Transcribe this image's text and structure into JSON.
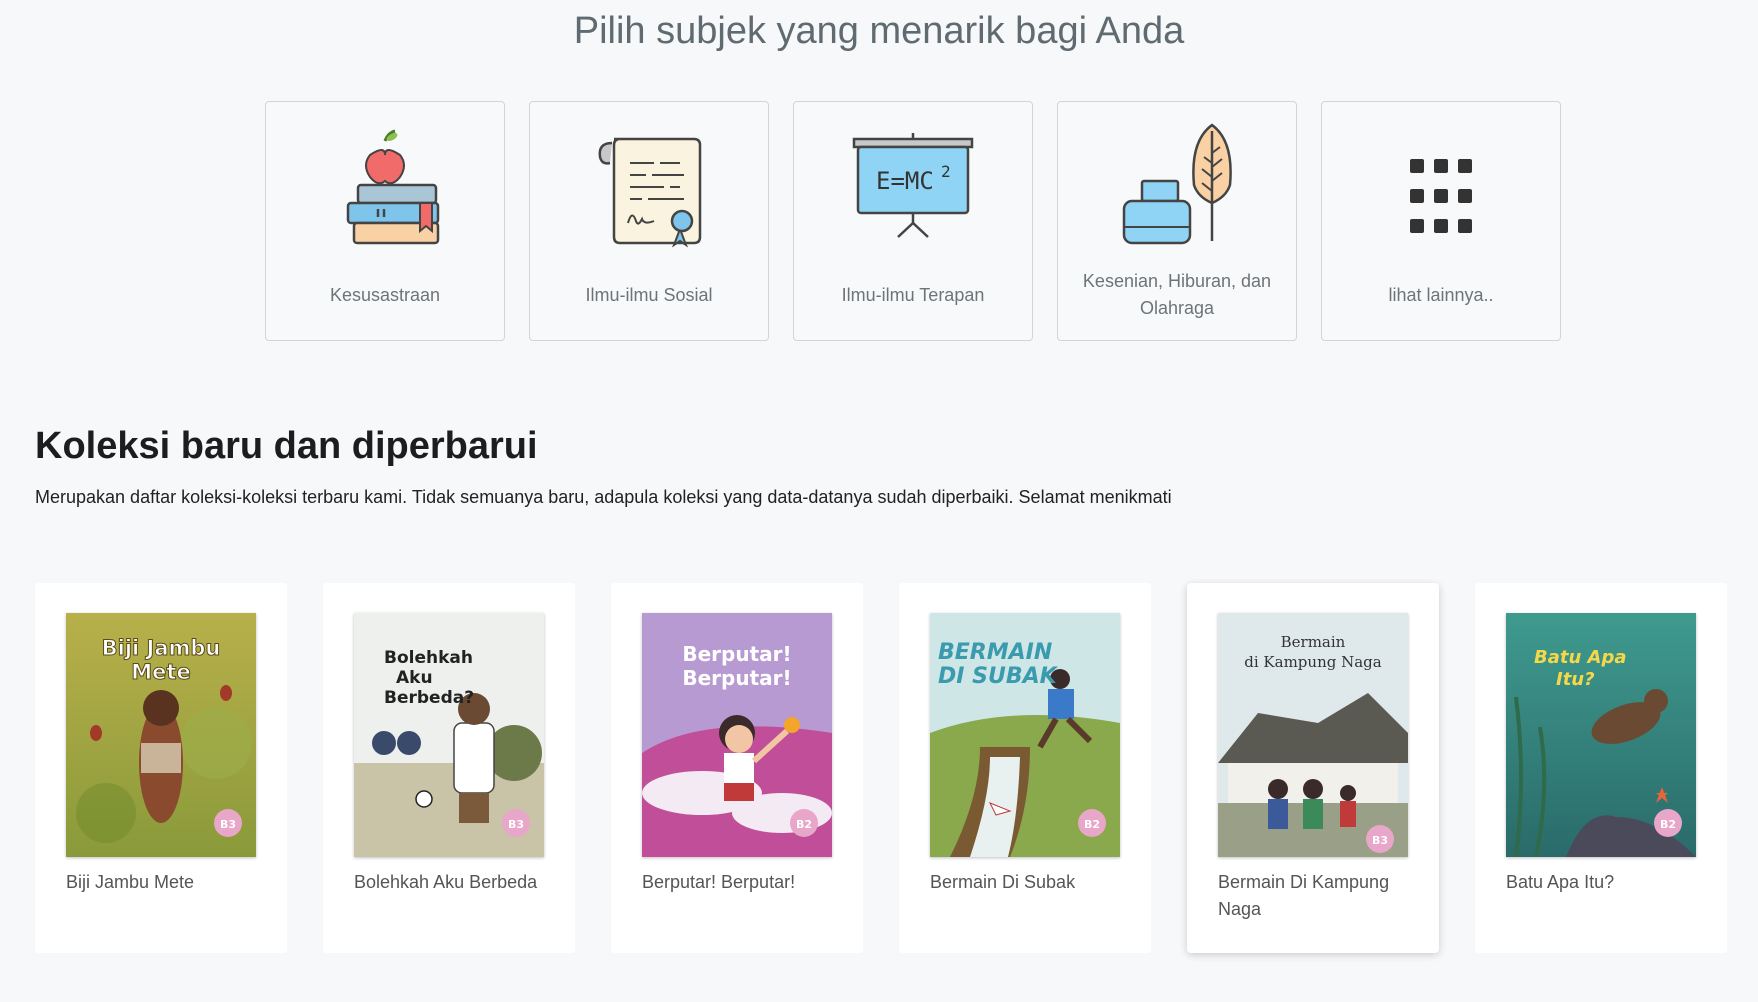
{
  "subjects_heading": "Pilih subjek yang menarik bagi Anda",
  "subjects": [
    {
      "label": "Kesusastraan",
      "icon": "books-apple-icon"
    },
    {
      "label": "Ilmu-ilmu Sosial",
      "icon": "certificate-scroll-icon"
    },
    {
      "label": "Ilmu-ilmu Terapan",
      "icon": "formula-board-icon"
    },
    {
      "label": "Kesenian, Hiburan, dan Olahraga",
      "icon": "ink-quill-icon"
    },
    {
      "label": "lihat lainnya..",
      "icon": "grid-dots-icon"
    }
  ],
  "collection": {
    "title": "Koleksi baru dan diperbarui",
    "description": "Merupakan daftar koleksi-koleksi terbaru kami. Tidak semuanya baru, adapula koleksi yang data-datanya sudah diperbaiki. Selamat menikmati"
  },
  "books": [
    {
      "title": "Biji Jambu Mete",
      "cover_title_line1": "Biji Jambu",
      "cover_title_line2": "Mete",
      "level": "B3",
      "cover_colors": [
        "#8a9a3a",
        "#b8b04a"
      ]
    },
    {
      "title": "Bolehkah Aku Berbeda",
      "cover_title_line1": "Bolehkah",
      "cover_title_line2": "Aku",
      "cover_title_line3": "Berbeda?",
      "level": "B3",
      "cover_colors": [
        "#eef0ee",
        "#c9c3a8"
      ]
    },
    {
      "title": "Berputar! Berputar!",
      "cover_title_line1": "Berputar!",
      "cover_title_line2": "Berputar!",
      "level": "B2",
      "cover_colors": [
        "#b89ad2",
        "#c04e98"
      ]
    },
    {
      "title": "Bermain Di Subak",
      "cover_title_line1": "BERMAIN",
      "cover_title_line2": "DI SUBAK",
      "level": "B2",
      "cover_colors": [
        "#cfe6e6",
        "#8aa84c"
      ]
    },
    {
      "title": "Bermain Di Kampung Naga",
      "cover_title_line1": "Bermain",
      "cover_title_line2": "di Kampung Naga",
      "level": "B3",
      "cover_colors": [
        "#dfe9ec",
        "#9a9f88"
      ]
    },
    {
      "title": "Batu Apa Itu?",
      "cover_title_line1": "Batu Apa",
      "cover_title_line2": "Itu?",
      "level": "B2",
      "cover_colors": [
        "#3f9a8e",
        "#2a6b6a"
      ]
    }
  ]
}
